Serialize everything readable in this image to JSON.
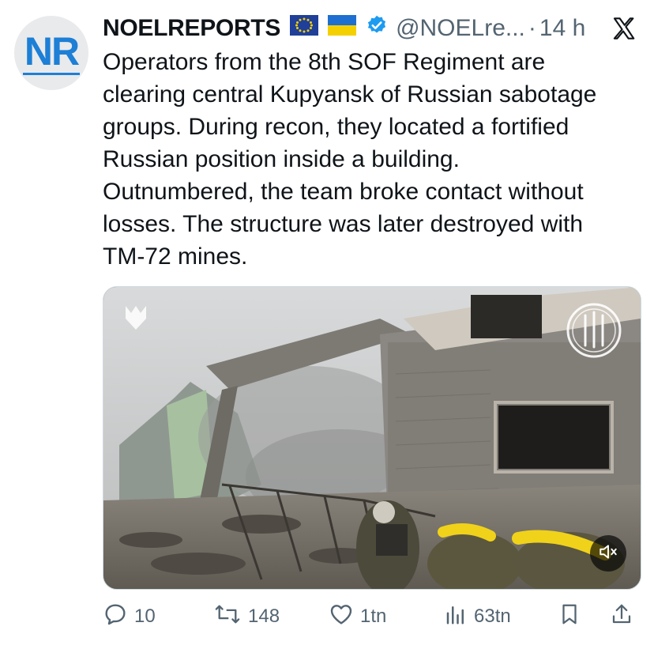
{
  "author": {
    "avatar_initials": "NR",
    "name": "NOELREPORTS",
    "flags": [
      "eu-flag-icon",
      "ukraine-flag-icon"
    ],
    "verified_icon": "verified-badge-icon",
    "handle": "@NOELre...",
    "separator": "·",
    "time": "14 h"
  },
  "platform_icon": "x-logo-icon",
  "post": {
    "text": "Operators from the 8th SOF Regiment are\nclearing central Kupyansk of Russian sabotage\ngroups. During recon, they located a fortified\nRussian position inside a building.\nOutnumbered, the team broke contact without\nlosses. The structure was later destroyed with\nTM-72 mines."
  },
  "media": {
    "type": "video",
    "overlay_icons": [
      "sof-emblem-icon",
      "regiment-emblem-icon"
    ],
    "mute_icon": "muted-speaker-icon"
  },
  "actions": {
    "replies": "10",
    "reposts": "148",
    "likes": "1tn",
    "views": "63tn",
    "icons": [
      "reply-icon",
      "repost-icon",
      "like-icon",
      "views-icon",
      "bookmark-icon",
      "share-icon"
    ]
  },
  "colors": {
    "accent": "#1d9bf0",
    "text": "#0f1419",
    "secondary": "#536471"
  }
}
